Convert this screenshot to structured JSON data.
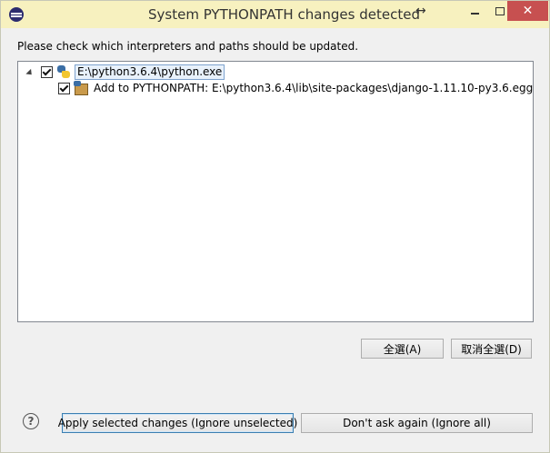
{
  "window": {
    "title": "System PYTHONPATH changes detected",
    "close_label": "✕",
    "resize_glyph": "↔"
  },
  "instruction": "Please check which interpreters and paths should be updated.",
  "tree": {
    "interpreter": {
      "label": "E:\\python3.6.4\\python.exe",
      "checked": true,
      "expanded": true,
      "icon": "python-icon"
    },
    "paths": [
      {
        "label": "Add to PYTHONPATH: E:\\python3.6.4\\lib\\site-packages\\django-1.11.10-py3.6.egg",
        "checked": true,
        "icon": "egg-package-icon"
      }
    ]
  },
  "buttons": {
    "select_all": "全選(A)",
    "deselect_all": "取消全選(D)",
    "apply": "Apply selected changes (Ignore unselected)",
    "dont_ask": "Don't ask again (Ignore all)",
    "help": "?"
  },
  "colors": {
    "titlebar": "#f7f1bf",
    "close": "#c75050",
    "selection_border": "#7da2ce"
  }
}
